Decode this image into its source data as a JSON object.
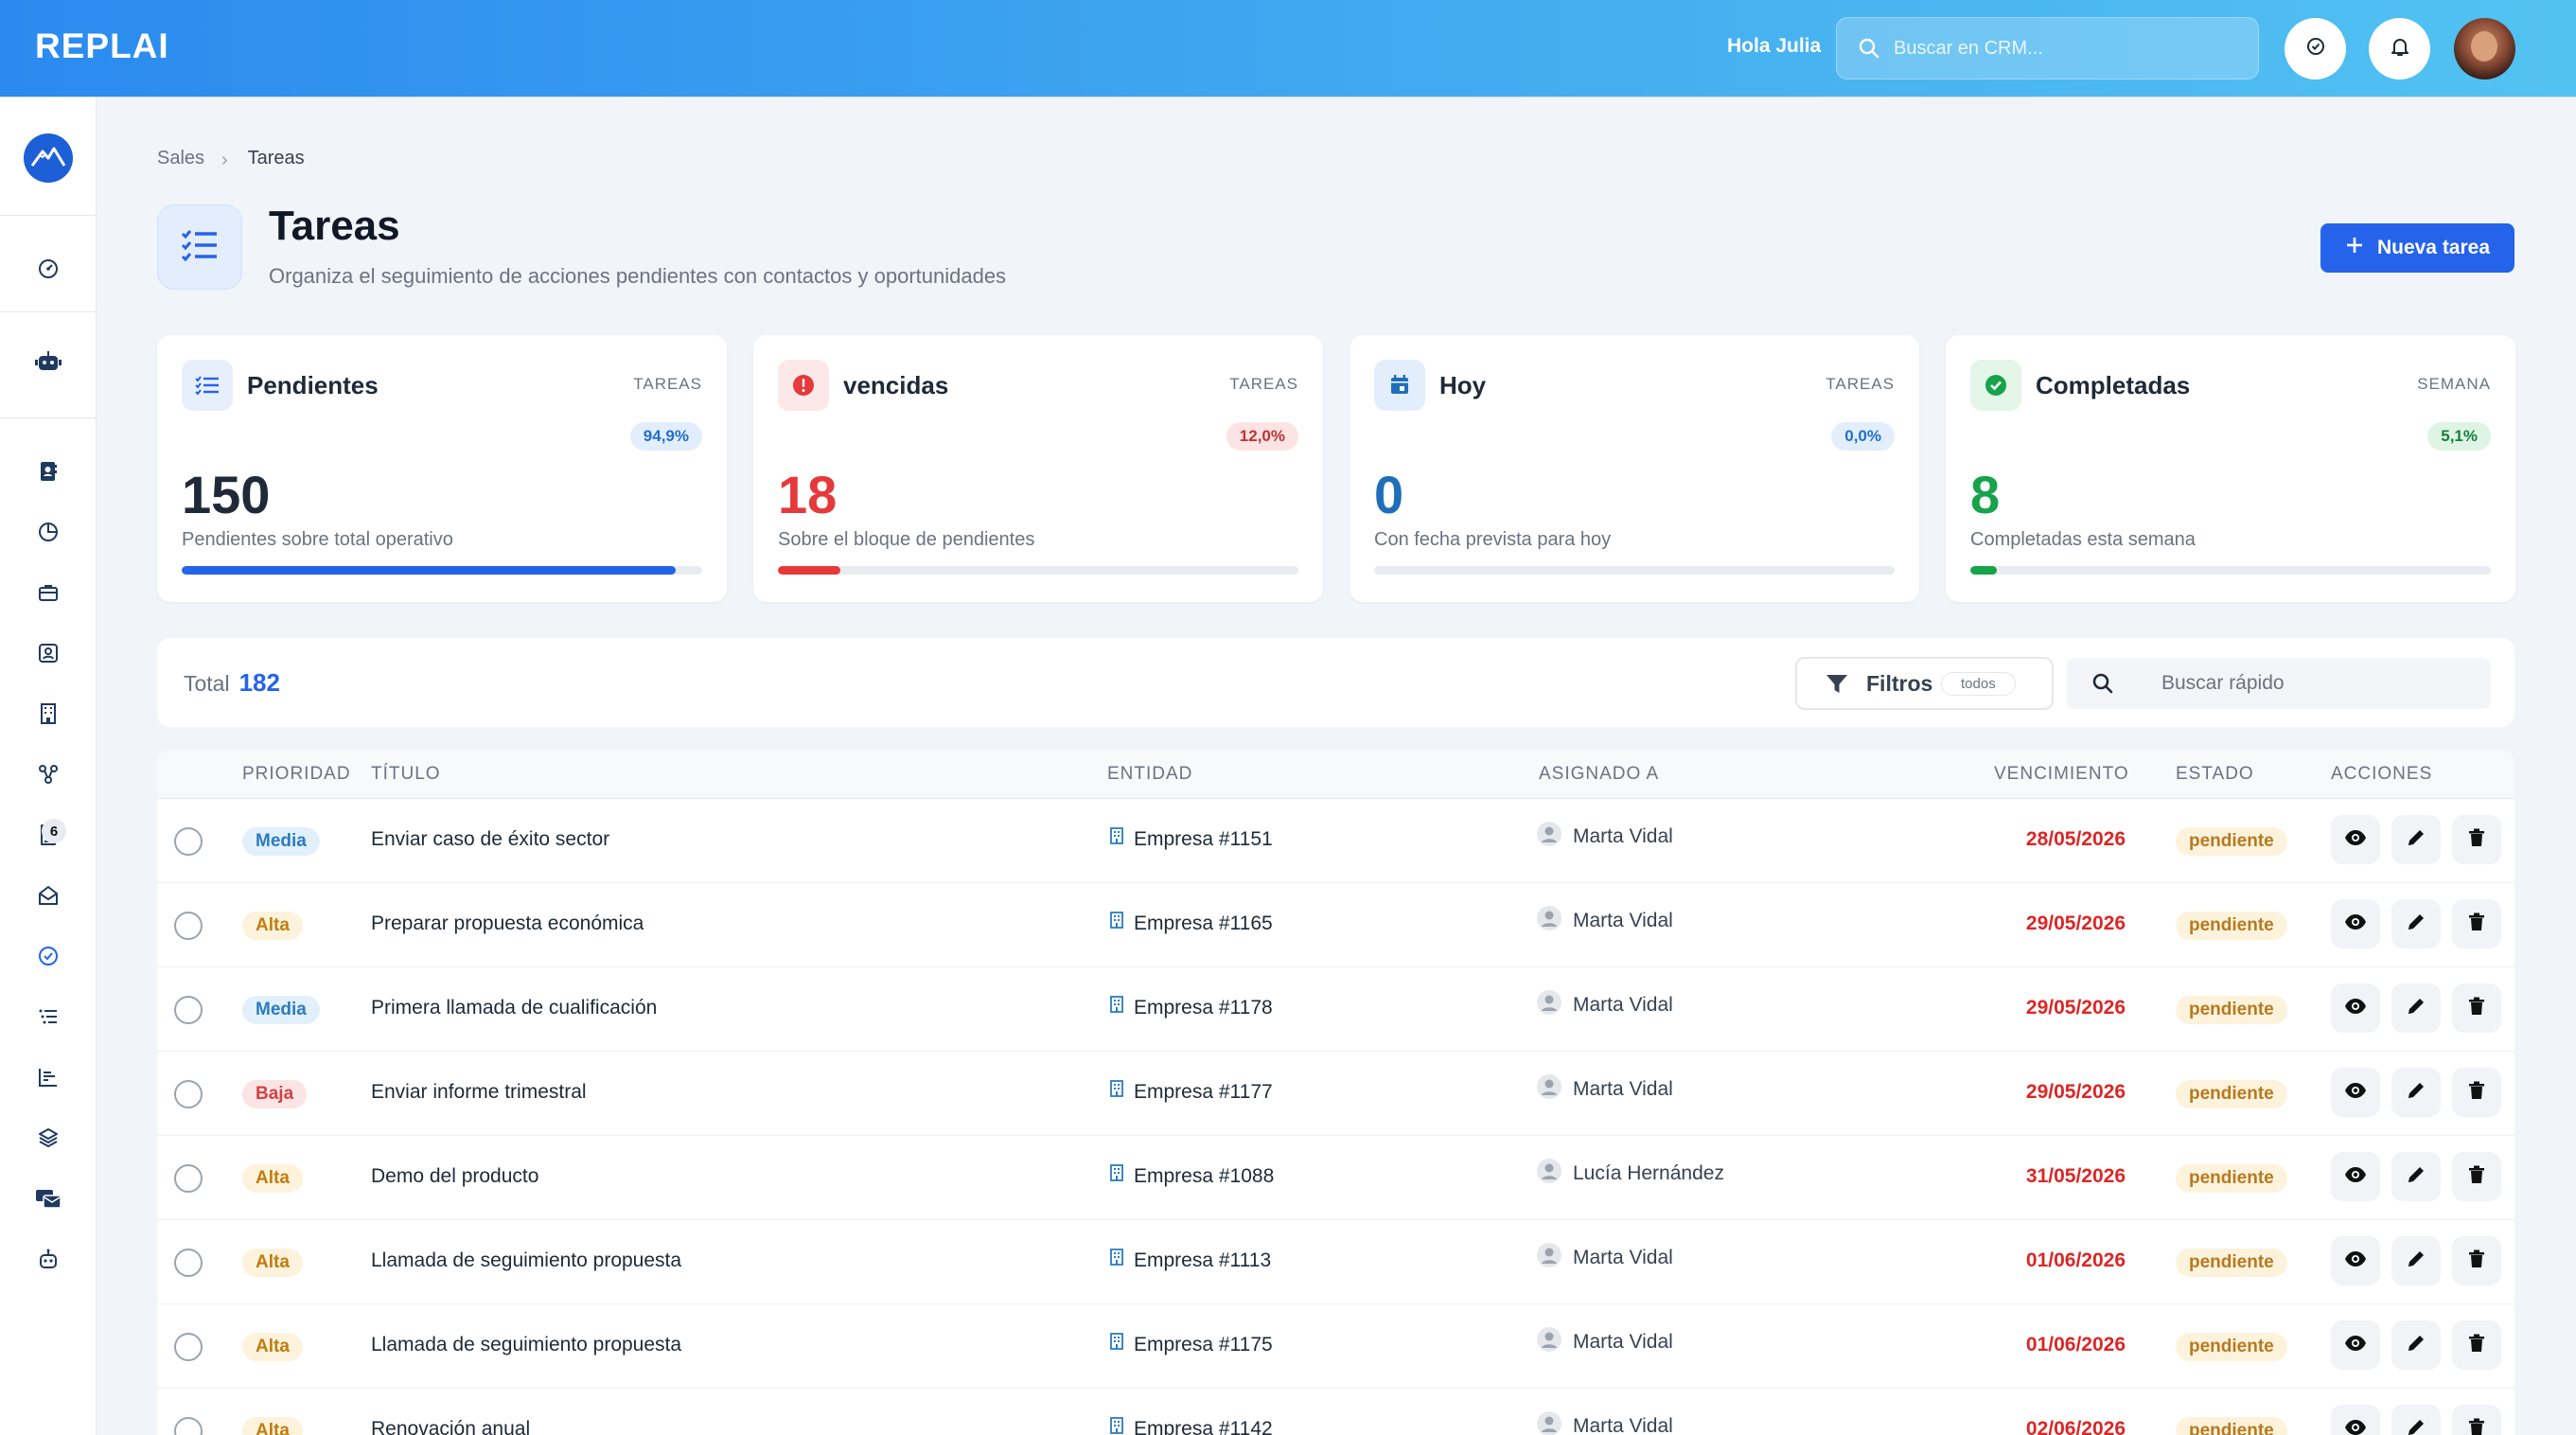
{
  "brand": {
    "logo": "REPLAI"
  },
  "header": {
    "greeting": "Hola Julia",
    "search_placeholder": "Buscar en CRM..."
  },
  "sidebar": {
    "badge": "6"
  },
  "breadcrumb": {
    "root": "Sales",
    "separator": "›",
    "current": "Tareas"
  },
  "page": {
    "title": "Tareas",
    "subtitle": "Organiza el seguimiento de acciones pendientes con contactos y oportunidades",
    "new_button": "Nueva tarea"
  },
  "cards": [
    {
      "title": "Pendientes",
      "kicker": "TAREAS",
      "pct": "94,9%",
      "value": "150",
      "desc": "Pendientes sobre total operativo",
      "fill": 0.949,
      "color": "#2563eb"
    },
    {
      "title": "vencidas",
      "kicker": "TAREAS",
      "pct": "12,0%",
      "value": "18",
      "desc": "Sobre el bloque de pendientes",
      "fill": 0.12,
      "color": "#e5393b"
    },
    {
      "title": "Hoy",
      "kicker": "TAREAS",
      "pct": "0,0%",
      "value": "0",
      "desc": "Con fecha prevista para hoy",
      "fill": 0.0,
      "color": "#1f6fb8"
    },
    {
      "title": "Completadas",
      "kicker": "SEMANA",
      "pct": "5,1%",
      "value": "8",
      "desc": "Completadas esta semana",
      "fill": 0.051,
      "color": "#16a34a"
    }
  ],
  "filters": {
    "total_label": "Total",
    "total_value": "182",
    "filters_label": "Filtros",
    "filters_tag": "todos",
    "quick_search_placeholder": "Buscar rápido"
  },
  "table": {
    "columns": [
      "PRIORIDAD",
      "TÍTULO",
      "ENTIDAD",
      "ASIGNADO A",
      "VENCIMIENTO",
      "ESTADO",
      "ACCIONES"
    ],
    "rows": [
      {
        "priority": "Media",
        "title": "Enviar caso de éxito sector",
        "entity": "Empresa #1151",
        "assignee": "Marta Vidal",
        "due": "28/05/2026",
        "status": "pendiente"
      },
      {
        "priority": "Alta",
        "title": "Preparar propuesta económica",
        "entity": "Empresa #1165",
        "assignee": "Marta Vidal",
        "due": "29/05/2026",
        "status": "pendiente"
      },
      {
        "priority": "Media",
        "title": "Primera llamada de cualificación",
        "entity": "Empresa #1178",
        "assignee": "Marta Vidal",
        "due": "29/05/2026",
        "status": "pendiente"
      },
      {
        "priority": "Baja",
        "title": "Enviar informe trimestral",
        "entity": "Empresa #1177",
        "assignee": "Marta Vidal",
        "due": "29/05/2026",
        "status": "pendiente"
      },
      {
        "priority": "Alta",
        "title": "Demo del producto",
        "entity": "Empresa #1088",
        "assignee": "Lucía Hernández",
        "due": "31/05/2026",
        "status": "pendiente"
      },
      {
        "priority": "Alta",
        "title": "Llamada de seguimiento propuesta",
        "entity": "Empresa #1113",
        "assignee": "Marta Vidal",
        "due": "01/06/2026",
        "status": "pendiente"
      },
      {
        "priority": "Alta",
        "title": "Llamada de seguimiento propuesta",
        "entity": "Empresa #1175",
        "assignee": "Marta Vidal",
        "due": "01/06/2026",
        "status": "pendiente"
      },
      {
        "priority": "Alta",
        "title": "Renovación anual",
        "entity": "Empresa #1142",
        "assignee": "Marta Vidal",
        "due": "02/06/2026",
        "status": "pendiente"
      }
    ]
  },
  "colors": {
    "accent": "#2563eb",
    "danger": "#dc2626",
    "success": "#16a34a"
  }
}
